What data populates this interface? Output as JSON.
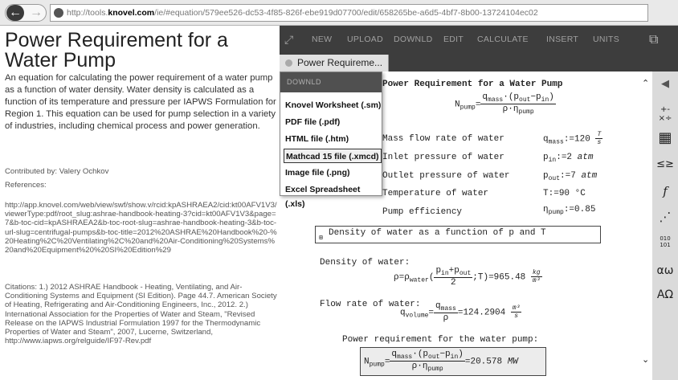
{
  "browser": {
    "url_prefix": "http://tools.",
    "url_domain": "knovel.com",
    "url_suffix": "/ie/#equation/579ee526-dc53-4f85-826f-ebe919d07700/edit/658265be-a6d5-4bf7-8b00-13724104ec02"
  },
  "left": {
    "title": "Power Requirement for a Water Pump",
    "description": "An equation for calculating the power requirement of a water pump as a function of water density. Water density is calculated as a function of its temperature and pressure per IAPWS Formulation for Region 1. This equation can be used for pump selection in a variety of industries, including chemical process and power generation.",
    "contributed": "Contributed by: Valery Ochkov",
    "references_label": "References:",
    "reference_url": "http://app.knovel.com/web/view/swf/show.v/rcid:kpASHRAEA2/cid:kt00AFV1V3/viewerType:pdf/root_slug:ashrae-handbook-heating-3?cid=kt00AFV1V3&page=7&b-toc-cid=kpASHRAEA2&b-toc-root-slug=ashrae-handbook-heating-3&b-toc-url-slug=centrifugal-pumps&b-toc-title=2012%20ASHRAE%20Handbook%20-%20Heating%2C%20Ventilating%2C%20and%20Air-Conditioning%20Systems%20and%20Equipment%20%20SI%20Edition%29",
    "citations": "Citations: 1.) 2012 ASHRAE Handbook - Heating, Ventilating, and Air-Conditioning Systems and Equipment (SI Edition). Page 44.7. American Society of Heating, Refrigerating and Air-Conditioning Engineers, Inc., 2012. 2.) International Association for the Properties of Water and Steam, \"Revised Release on the IAPWS Industrial Formulation 1997 for the Thermodynamic Properties of Water and Steam\", 2007, Lucerne, Switzerland, http://www.iapws.org/relguide/IF97-Rev.pdf"
  },
  "toolbar": {
    "items": [
      "NEW",
      "UPLOAD",
      "DOWNLD",
      "EDIT",
      "CALCULATE",
      "INSERT",
      "UNITS"
    ]
  },
  "tab": {
    "label": "Power Requireme..."
  },
  "menu": {
    "header": "DOWNLD",
    "items": [
      "Knovel Worksheet (.sm)",
      "PDF file (.pdf)",
      "HTML file (.htm)",
      "Mathcad 15 file (.xmcd)",
      "Image file (.png)",
      "Excel Spreadsheet (.xls)"
    ],
    "selected": "Mathcad 15 file (.xmcd)"
  },
  "sheet": {
    "heading": "Power Requirement for a Water Pump",
    "inputs": [
      {
        "label": "Mass flow rate of water",
        "var": "q",
        "sub": "mass",
        "val": "120",
        "unit_n": "T",
        "unit_d": "s"
      },
      {
        "label": "Inlet pressure of water",
        "var": "p",
        "sub": "in",
        "val": "2",
        "unit": "atm"
      },
      {
        "label": "Outlet pressure of water",
        "var": "p",
        "sub": "out",
        "val": "7",
        "unit": "atm"
      },
      {
        "label": "Temperature of water",
        "var": "T",
        "sub": "",
        "val": "90",
        "unit": "°C"
      },
      {
        "label": "Pump efficiency",
        "var": "η",
        "sub": "pump",
        "val": "0.85",
        "unit": ""
      }
    ],
    "density_region": "Density of water as a function of p and T",
    "density_label": "Density of water:",
    "density_result": "965.48",
    "flow_label": "Flow rate of water:",
    "flow_result": "124.2904",
    "power_label": "Power requirement for the water pump:",
    "power_result": "20.578",
    "power_unit": "MW"
  },
  "palette": {
    "items": [
      "◀",
      "+-×÷",
      "▦",
      "≤≥",
      "f",
      "⋰",
      "010101",
      "αω",
      "ΑΩ"
    ]
  }
}
